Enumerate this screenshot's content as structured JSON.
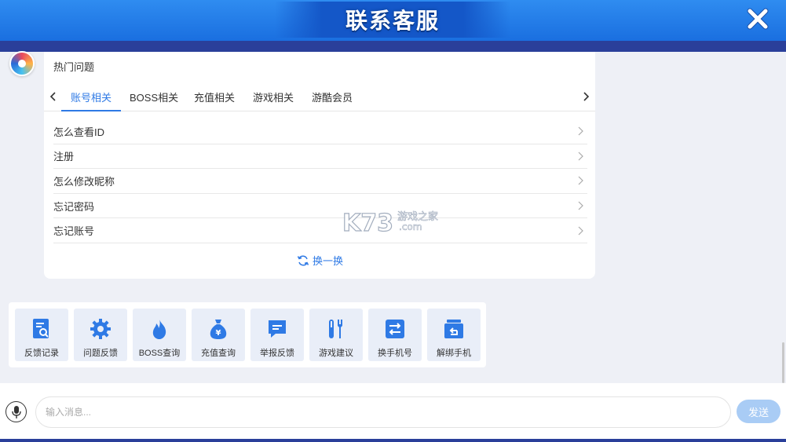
{
  "header": {
    "title": "联系客服"
  },
  "faq": {
    "title": "热门问题",
    "tabs": [
      {
        "label": "账号相关",
        "active": true
      },
      {
        "label": "BOSS相关",
        "active": false
      },
      {
        "label": "充值相关",
        "active": false
      },
      {
        "label": "游戏相关",
        "active": false
      },
      {
        "label": "游酷会员",
        "active": false
      }
    ],
    "questions": [
      "怎么查看ID",
      "注册",
      "怎么修改昵称",
      "忘记密码",
      "忘记账号"
    ],
    "refresh_label": "换一换"
  },
  "actions": [
    {
      "label": "反馈记录",
      "icon": "feedback-record-icon"
    },
    {
      "label": "问题反馈",
      "icon": "gear-icon"
    },
    {
      "label": "BOSS查询",
      "icon": "flame-icon"
    },
    {
      "label": "充值查询",
      "icon": "money-bag-icon"
    },
    {
      "label": "举报反馈",
      "icon": "chat-report-icon"
    },
    {
      "label": "游戏建议",
      "icon": "tools-icon"
    },
    {
      "label": "换手机号",
      "icon": "swap-phone-icon"
    },
    {
      "label": "解绑手机",
      "icon": "unbind-phone-icon"
    }
  ],
  "input": {
    "placeholder": "输入消息...",
    "value": ""
  },
  "send_label": "发送",
  "watermark": {
    "brand": "K73",
    "text1": "游戏之家",
    "text2": ".com"
  },
  "colors": {
    "accent": "#2f7ae5",
    "header": "#1a6fe0",
    "stripe": "#2a3f9a",
    "send": "#a9ccf5"
  }
}
